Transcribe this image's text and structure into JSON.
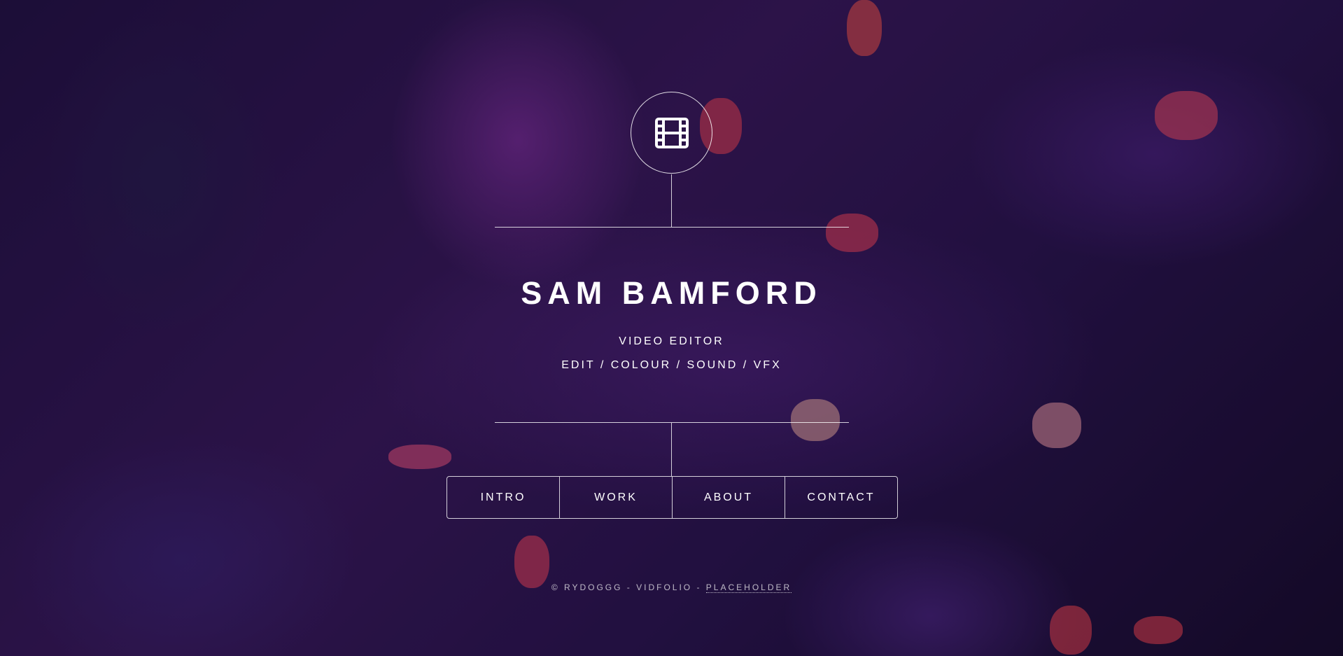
{
  "header": {
    "logo_icon": "film-icon",
    "name": "SAM BAMFORD",
    "role": "VIDEO EDITOR",
    "skills": "EDIT / COLOUR / SOUND / VFX"
  },
  "nav": {
    "items": [
      {
        "label": "INTRO"
      },
      {
        "label": "WORK"
      },
      {
        "label": "ABOUT"
      },
      {
        "label": "CONTACT"
      }
    ]
  },
  "footer": {
    "credit": "© RYDOGGG - VIDFOLIO - ",
    "link_label": "PLACEHOLDER"
  },
  "colors": {
    "text": "#ffffff",
    "background_tint": "#2a1550"
  }
}
